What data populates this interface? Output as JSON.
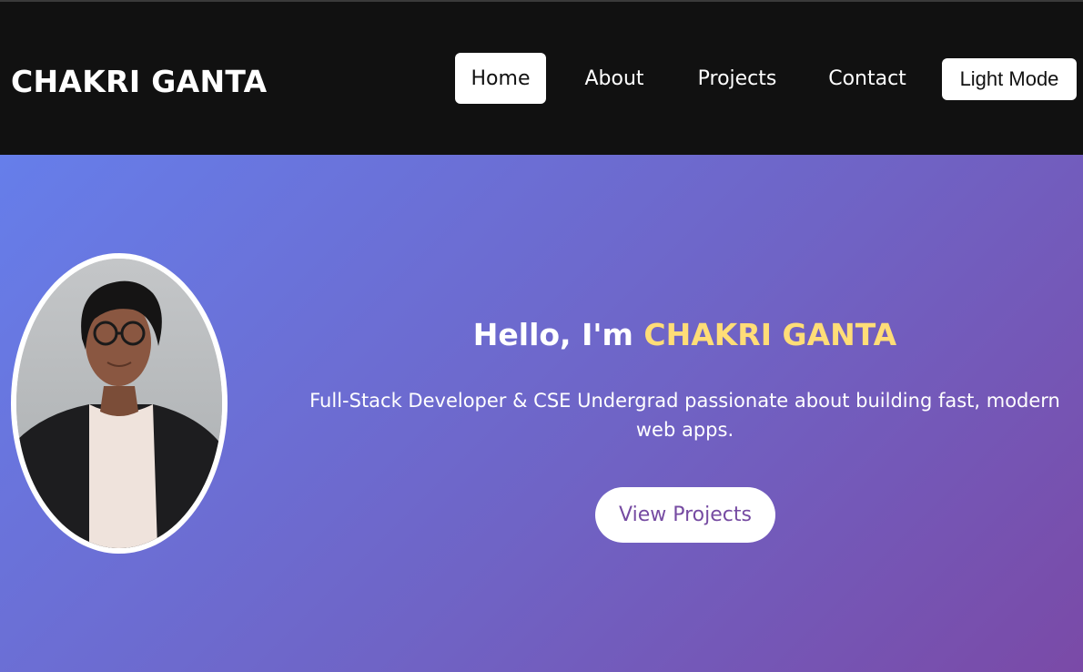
{
  "header": {
    "brand": "CHAKRI GANTA",
    "nav": [
      {
        "label": "Home",
        "active": true
      },
      {
        "label": "About",
        "active": false
      },
      {
        "label": "Projects",
        "active": false
      },
      {
        "label": "Contact",
        "active": false
      }
    ],
    "theme_toggle_label": "Light Mode"
  },
  "hero": {
    "greeting": "Hello, I'm",
    "name": "CHAKRI GANTA",
    "subtitle": "Full-Stack Developer & CSE Undergrad passionate about building fast, modern web apps.",
    "cta_label": "View Projects"
  },
  "colors": {
    "navbar_bg": "#111111",
    "gradient_start": "#667eea",
    "gradient_end": "#764ba2",
    "name_highlight": "#ffdd77",
    "cta_text": "#764ba2"
  }
}
